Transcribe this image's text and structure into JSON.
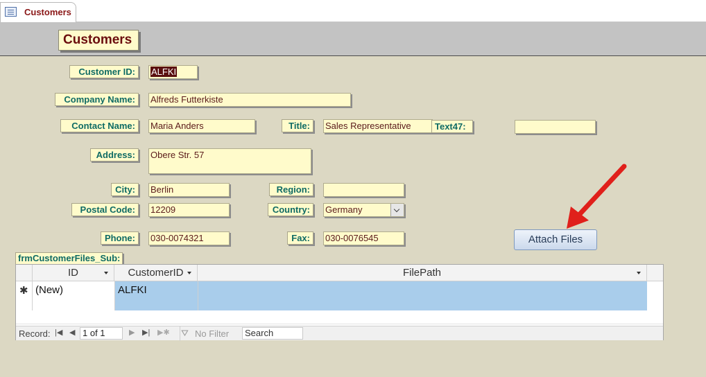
{
  "tab": {
    "title": "Customers",
    "icon": "form-icon"
  },
  "form": {
    "title": "Customers"
  },
  "fields": {
    "customer_id": {
      "label": "Customer ID:",
      "value": "ALFKI"
    },
    "company_name": {
      "label": "Company Name:",
      "value": "Alfreds Futterkiste"
    },
    "contact_name": {
      "label": "Contact Name:",
      "value": "Maria Anders"
    },
    "title": {
      "label": "Title:",
      "value": "Sales Representative"
    },
    "text47": {
      "label": "Text47:",
      "value": ""
    },
    "address": {
      "label": "Address:",
      "value": "Obere Str. 57"
    },
    "city": {
      "label": "City:",
      "value": "Berlin"
    },
    "region": {
      "label": "Region:",
      "value": ""
    },
    "postal_code": {
      "label": "Postal Code:",
      "value": "12209"
    },
    "country": {
      "label": "Country:",
      "value": "Germany"
    },
    "phone": {
      "label": "Phone:",
      "value": "030-0074321"
    },
    "fax": {
      "label": "Fax:",
      "value": "030-0076545"
    }
  },
  "attach_button": {
    "label": "Attach Files"
  },
  "subform": {
    "label": "frmCustomerFiles_Sub:",
    "columns": [
      "ID",
      "CustomerID",
      "FilePath"
    ],
    "new_row": {
      "selector": "✱",
      "id": "(New)",
      "customer_id": "ALFKI",
      "file_path": ""
    }
  },
  "navigation": {
    "record_label": "Record:",
    "position": "1 of 1",
    "filter_label": "No Filter",
    "search_placeholder": "Search"
  },
  "colors": {
    "label_text": "#0e6b64",
    "field_bg": "#fffbcb",
    "title_text": "#6b0e0e",
    "arrow": "#e0201b",
    "new_row_bg": "#a9cdeb"
  }
}
